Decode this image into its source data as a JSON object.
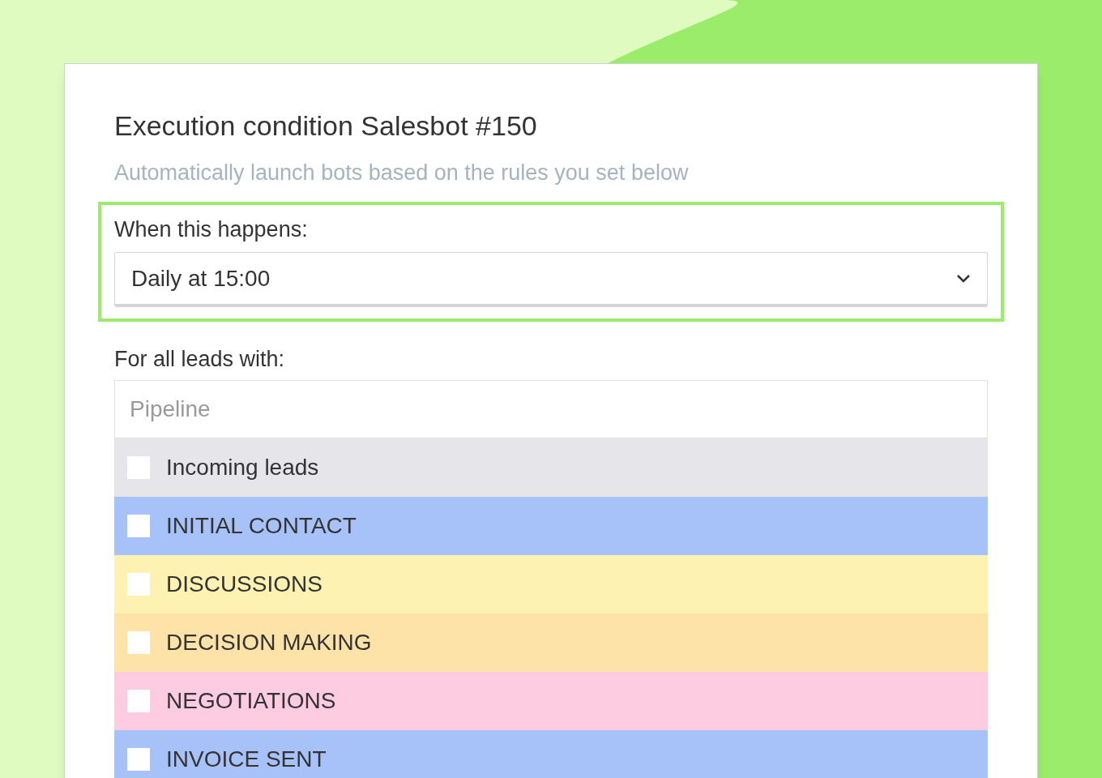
{
  "dialog": {
    "title": "Execution condition Salesbot #150",
    "subtitle": "Automatically launch bots based on the rules you set below"
  },
  "trigger": {
    "label": "When this happens:",
    "value": "Daily at 15:00",
    "highlighted": true
  },
  "filter": {
    "label": "For all leads with:",
    "search": {
      "placeholder": "Pipeline"
    },
    "stages": [
      {
        "label": "Incoming leads",
        "color": "#e5e5ea",
        "checked": false
      },
      {
        "label": "INITIAL CONTACT",
        "color": "#a7c2f8",
        "checked": false
      },
      {
        "label": "DISCUSSIONS",
        "color": "#fef2b3",
        "checked": false
      },
      {
        "label": "DECISION MAKING",
        "color": "#fde3a8",
        "checked": false
      },
      {
        "label": "NEGOTIATIONS",
        "color": "#fecce0",
        "checked": false
      },
      {
        "label": "INVOICE SENT",
        "color": "#a7c2f8",
        "checked": false
      }
    ]
  }
}
